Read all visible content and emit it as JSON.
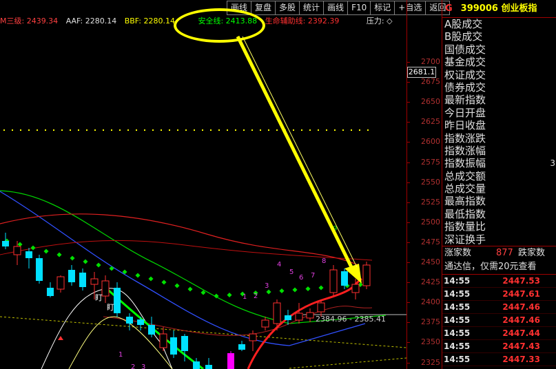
{
  "toolbar": {
    "buttons": [
      "画线",
      "复盘",
      "多股",
      "统计",
      "画线",
      "F10",
      "标记",
      "+自选",
      "返回"
    ]
  },
  "indicators": {
    "san": "M三级: 2439.34",
    "aaf": "AAF: 2280.14",
    "bbf": "BBF: 2280.14",
    "safe": "安全线: 2413.88",
    "life": "生命辅助线: 2392.39",
    "pressure": "压力: ◇"
  },
  "y_axis": {
    "current": "2681.1",
    "labels": [
      "2700",
      "2675",
      "2650",
      "2625",
      "2600",
      "2575",
      "2550",
      "2525",
      "2500",
      "2475",
      "2450",
      "2425",
      "2400",
      "2375",
      "2350",
      "2325"
    ]
  },
  "annotations": {
    "range": "2384.96 - 2385.41",
    "digits_magenta": [
      "1",
      "2",
      "3",
      "4",
      "5",
      "6",
      "7",
      "8"
    ],
    "digit_green": "9",
    "lower_digits": [
      "1",
      "2",
      "3"
    ],
    "hl": "盯"
  },
  "panel": {
    "code": "399006",
    "name": "创业板指",
    "market_tag": "G",
    "fields": [
      "A股成交",
      "B股成交",
      "国债成交",
      "基金成交",
      "权证成交",
      "债券成交",
      "最新指数",
      "今日开盘",
      "昨日收盘",
      "指数涨跌",
      "指数涨幅",
      "指数振幅",
      "总成交额",
      "总成交量",
      "最高指数",
      "最低指数",
      "指数量比",
      "深证换手"
    ],
    "amplitude_partial": "3",
    "up_label": "涨家数",
    "up_count": "877",
    "down_label": "跌家数",
    "promo": "通达信，仅需20元查看",
    "ticks": [
      {
        "time": "14:55",
        "price": "2447.53"
      },
      {
        "time": "14:55",
        "price": "2447.61"
      },
      {
        "time": "14:55",
        "price": "2447.46"
      },
      {
        "time": "14:55",
        "price": "2447.46"
      },
      {
        "time": "14:55",
        "price": "2447.44"
      },
      {
        "time": "14:55",
        "price": "2447.43"
      },
      {
        "time": "14:55",
        "price": "2447.33"
      }
    ]
  },
  "colors": {
    "up": "#ff3030",
    "down": "#00e0ff",
    "highlight": "#ffff00",
    "ma_green": "#00d000",
    "ma_blue": "#3050ff",
    "ma_red": "#e02020"
  }
}
